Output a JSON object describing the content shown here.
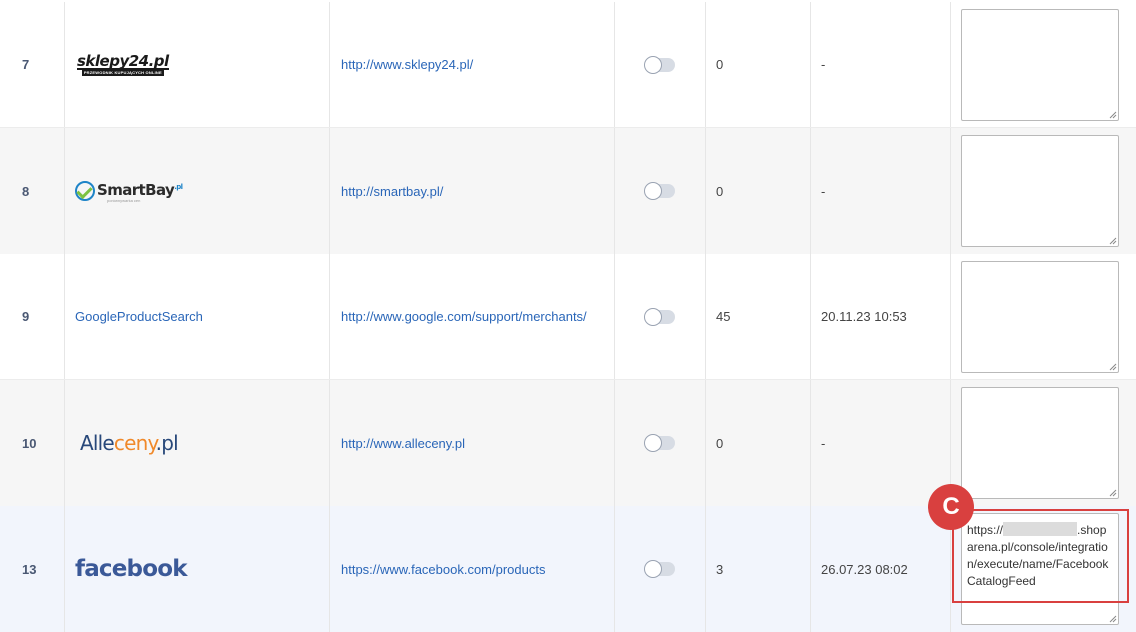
{
  "rows": [
    {
      "id": "7",
      "logo": "sklepy24",
      "logo_text": "sklepy24.pl",
      "logo_subtext": "PRZEWODNIK KUPUJĄCYCH ONLINE",
      "url": "http://www.sklepy24.pl/",
      "count": "0",
      "date": "-",
      "textarea": ""
    },
    {
      "id": "8",
      "logo": "smartbay",
      "logo_text": "SmartBay",
      "logo_sup": ".pl",
      "logo_subtext": "porównywarka cen",
      "url": "http://smartbay.pl/",
      "count": "0",
      "date": "-",
      "textarea": ""
    },
    {
      "id": "9",
      "logo": "text",
      "logo_text": "GoogleProductSearch",
      "url": "http://www.google.com/support/merchants/",
      "count": "45",
      "date": "20.11.23 10:53",
      "textarea": ""
    },
    {
      "id": "10",
      "logo": "alleceny",
      "logo_text_a": "Alle",
      "logo_text_b": "ceny",
      "logo_text_c": ".pl",
      "url": "http://www.alleceny.pl",
      "count": "0",
      "date": "-",
      "textarea": ""
    },
    {
      "id": "13",
      "logo": "facebook",
      "logo_text": "facebook",
      "url": "https://www.facebook.com/products",
      "count": "3",
      "date": "26.07.23 08:02",
      "textarea_prefix": "https://",
      "textarea_suffix": ".shoparena.pl/console/integration/execute/name/FacebookCatalogFeed"
    }
  ],
  "callout": {
    "label": "C",
    "color": "#d9403f"
  },
  "colors": {
    "link": "#2a66b8",
    "facebook": "#3b5998",
    "alleceny_orange": "#f0892a"
  }
}
